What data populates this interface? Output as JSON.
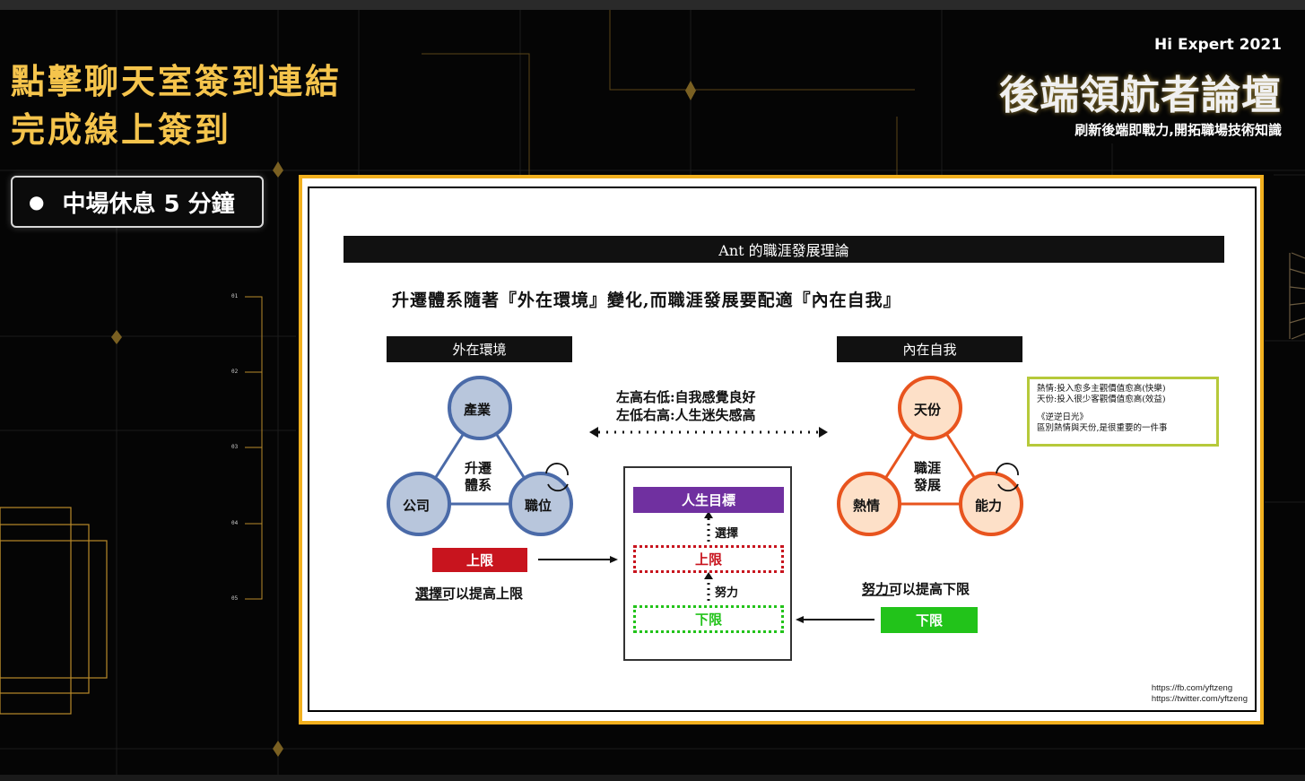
{
  "headline": {
    "line1": "點擊聊天室簽到連結",
    "line2": "完成線上簽到"
  },
  "brand": {
    "event": "Hi Expert  2021",
    "title": "後端領航者論壇",
    "subtitle": "刷新後端即戰力,開拓職場技術知識"
  },
  "break_notice": "中場休息 5 分鐘",
  "side_markers": [
    "01",
    "02",
    "03",
    "04",
    "05"
  ],
  "slide": {
    "title": "Ant 的職涯發展理論",
    "subtitle": "升遷體系隨著『外在環境』變化,而職涯發展要配適『內在自我』",
    "left_header": "外在環境",
    "right_header": "內在自我",
    "left_triangle": {
      "top": "產業",
      "left": "公司",
      "right": "職位",
      "center_line1": "升遷",
      "center_line2": "體系"
    },
    "right_triangle": {
      "top": "天份",
      "left": "熱情",
      "right": "能力",
      "center_line1": "職涯",
      "center_line2": "發展"
    },
    "middle_text_1": "左高右低:自我感覺良好",
    "middle_text_2": "左低右高:人生迷失感高",
    "upper_limit_tag": "上限",
    "lower_limit_tag": "下限",
    "choose_text": "選擇可以提高上限",
    "choose_word": "選擇",
    "effort_text": "努力可以提高下限",
    "effort_word": "努力",
    "center_box": {
      "goal": "人生目標",
      "choose": "選擇",
      "upper": "上限",
      "effort": "努力",
      "lower": "下限"
    },
    "note": {
      "line1": "熱情:投入愈多主觀價值愈高(快樂)",
      "line2": "天份:投入很少客觀價值愈高(效益)",
      "line3": "《逆逆日光》",
      "line4": "區別熱情與天份,是很重要的一件事"
    },
    "url1": "https://fb.com/yftzeng",
    "url2": "https://twitter.com/yftzeng"
  },
  "colors": {
    "accent_gold": "#f5c44c",
    "frame_orange": "#f2b01e",
    "left_circle_fill": "#b8c6dc",
    "left_circle_stroke": "#4a6aa8",
    "right_circle_fill": "#fde0c8",
    "right_circle_stroke": "#e8541e",
    "upper_red": "#c8141e",
    "lower_green": "#22c31a",
    "goal_purple": "#7030a0"
  }
}
